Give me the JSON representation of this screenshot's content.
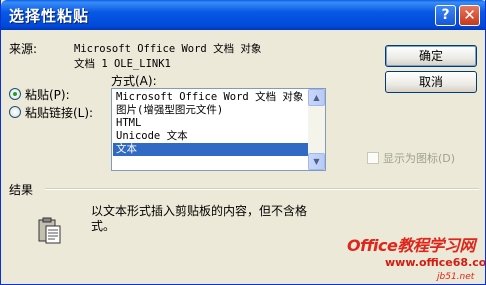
{
  "window": {
    "title": "选择性粘贴",
    "help_label": "?",
    "close_label": "✕"
  },
  "source": {
    "label": "来源:",
    "line1": "Microsoft Office Word 文档 对象",
    "line2": "文档 1 OLE_LINK1"
  },
  "buttons": {
    "ok": "确定",
    "cancel": "取消"
  },
  "as_label": "方式(A):",
  "options": {
    "paste": "粘贴(P):",
    "paste_link": "粘贴链接(L):",
    "selected": "paste"
  },
  "formats": {
    "items": [
      "Microsoft Office Word 文档 对象",
      "图片(增强型图元文件)",
      "HTML",
      "Unicode 文本",
      "文本"
    ],
    "selected_index": 4
  },
  "display_as_icon": {
    "label": "显示为图标(D)",
    "checked": false,
    "enabled": false
  },
  "result": {
    "heading": "结果",
    "text_line1": "以文本形式插入剪贴板的内容，但不含格",
    "text_line2": "式。"
  },
  "watermark": {
    "main": "Office教程学习网",
    "url": "www.office68.com",
    "small": "jb51.net"
  },
  "colors": {
    "titlebar": "#0859e6",
    "selection": "#316ac5",
    "dialog_bg": "#ece9d8",
    "watermark": "#e0261b"
  }
}
